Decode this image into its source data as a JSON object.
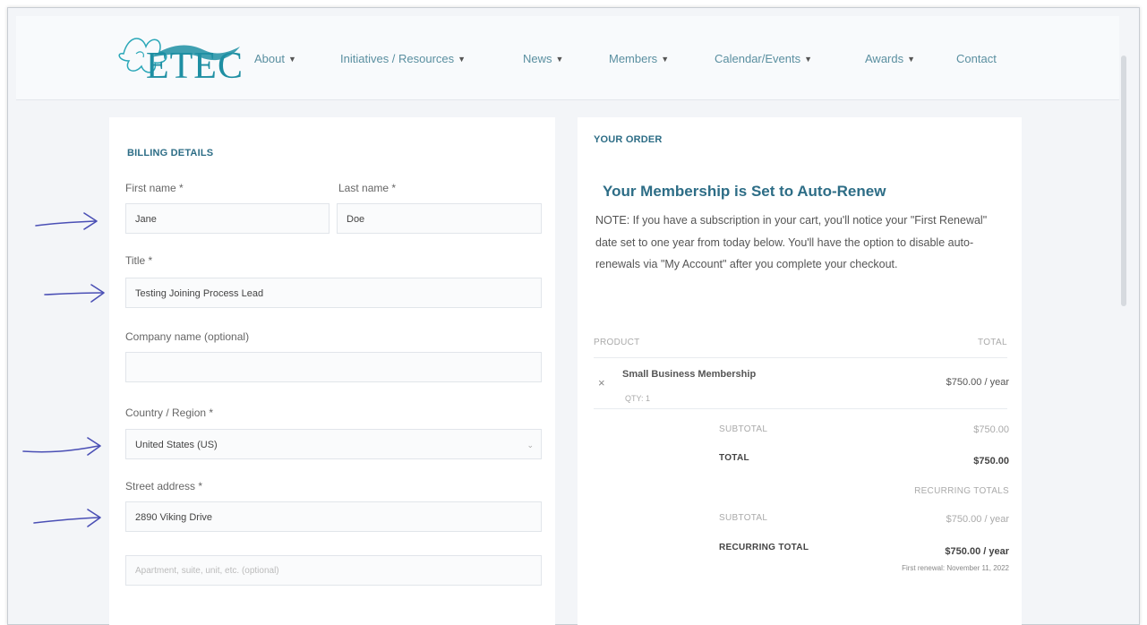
{
  "brand": {
    "logo_text": "ETEC"
  },
  "nav": [
    {
      "label": "About",
      "has_dropdown": true
    },
    {
      "label": "Initiatives / Resources",
      "has_dropdown": true
    },
    {
      "label": "News",
      "has_dropdown": true
    },
    {
      "label": "Members",
      "has_dropdown": true
    },
    {
      "label": "Calendar/Events",
      "has_dropdown": true
    },
    {
      "label": "Awards",
      "has_dropdown": true
    },
    {
      "label": "Contact",
      "has_dropdown": false
    }
  ],
  "billing": {
    "title": "BILLING DETAILS",
    "first_name_label": "First name *",
    "first_name_value": "Jane",
    "last_name_label": "Last name *",
    "last_name_value": "Doe",
    "title_label": "Title *",
    "title_value": "Testing Joining Process Lead",
    "company_label": "Company name (optional)",
    "company_value": "",
    "country_label": "Country / Region *",
    "country_value": "United States (US)",
    "street_label": "Street address *",
    "street_value": "2890 Viking Drive",
    "street2_placeholder": "Apartment, suite, unit, etc. (optional)"
  },
  "order": {
    "title": "YOUR ORDER",
    "auto_renew_heading": "Your Membership is Set to Auto-Renew",
    "note": "NOTE: If you have a subscription in your cart, you'll notice your \"First Renewal\" date set to one year from today below. You'll have the option to disable auto-renewals via \"My Account\" after you complete your checkout.",
    "col_product": "PRODUCT",
    "col_total": "TOTAL",
    "item_name": "Small Business Membership",
    "item_qty": "QTY: 1",
    "item_price": "$750.00 / year",
    "subtotal_label": "SUBTOTAL",
    "subtotal_value": "$750.00",
    "total_label": "TOTAL",
    "total_value": "$750.00",
    "recurring_totals_label": "RECURRING TOTALS",
    "recurring_subtotal_label": "SUBTOTAL",
    "recurring_subtotal_value": "$750.00 / year",
    "recurring_total_label": "RECURRING TOTAL",
    "recurring_total_value": "$750.00 / year",
    "first_renewal": "First renewal: November 11, 2022"
  },
  "colors": {
    "accent": "#2d6d86",
    "logo": "#1e8fa3",
    "annotation_arrow": "#4a4fb5"
  },
  "icons": {
    "logo": "etec-wave-flower-logo",
    "dropdown": "caret-down-icon",
    "remove": "close-icon",
    "select": "chevron-down-icon",
    "annotation": "hand-drawn-arrow-icon"
  }
}
